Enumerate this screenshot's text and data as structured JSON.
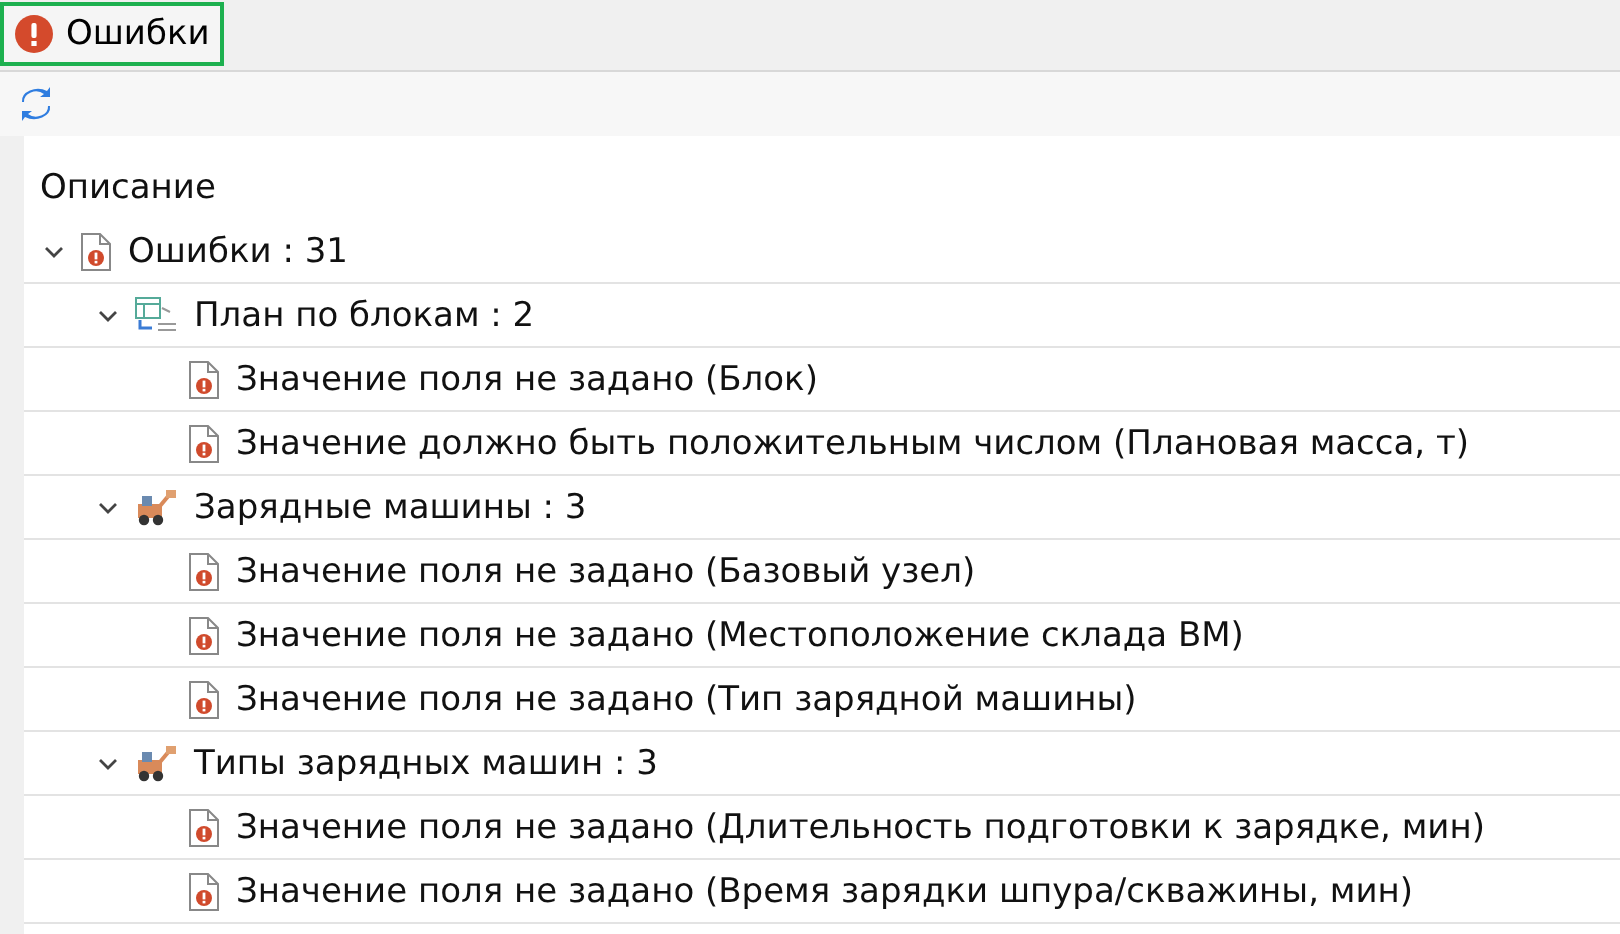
{
  "tab": {
    "label": "Ошибки",
    "selected": true
  },
  "tree": {
    "column": "Описание",
    "items": [
      {
        "kind": "errors",
        "label": "Ошибки : 31",
        "expanded": true,
        "children": [
          {
            "kind": "plan",
            "label": "План по блокам : 2",
            "expanded": true,
            "children": [
              {
                "kind": "error",
                "label": "Значение поля не задано (Блок)"
              },
              {
                "kind": "error",
                "label": "Значение должно быть положительным числом (Плановая масса, т)"
              }
            ]
          },
          {
            "kind": "machine",
            "label": "Зарядные машины : 3",
            "expanded": true,
            "children": [
              {
                "kind": "error",
                "label": "Значение поля не задано (Базовый узел)"
              },
              {
                "kind": "error",
                "label": "Значение поля не задано (Местоположение склада ВМ)"
              },
              {
                "kind": "error",
                "label": "Значение поля не задано (Тип зарядной машины)"
              }
            ]
          },
          {
            "kind": "machine",
            "label": "Типы зарядных машин : 3",
            "expanded": true,
            "children": [
              {
                "kind": "error",
                "label": "Значение поля не задано (Длительность подготовки к зарядке, мин)"
              },
              {
                "kind": "error",
                "label": "Значение поля не задано (Время зарядки шпура/скважины, мин)"
              }
            ]
          }
        ]
      }
    ]
  }
}
